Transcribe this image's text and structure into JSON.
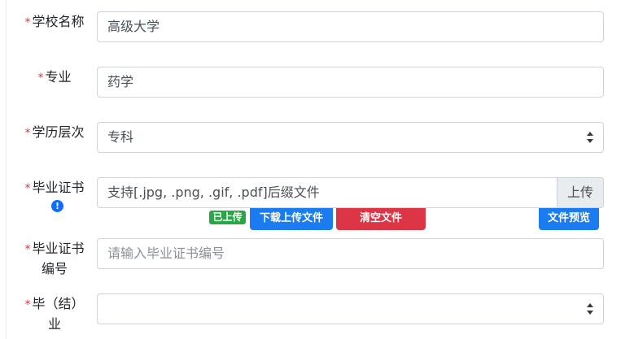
{
  "form": {
    "required_mark": "*",
    "school_name": {
      "label": "学校名称",
      "value": "高级大学"
    },
    "major": {
      "label": "专业",
      "value": "药学"
    },
    "education_level": {
      "label": "学历层次",
      "value": "专科"
    },
    "diploma": {
      "label": "毕业证书",
      "info_icon": "!",
      "placeholder": "支持[.jpg, .png, .gif, .pdf]后缀文件",
      "upload_button": "上传",
      "status_badge": "已上传",
      "download_button": "下载上传文件",
      "clear_button": "清空文件",
      "preview_button": "文件预览"
    },
    "diploma_number": {
      "label_line1": "毕业证书",
      "label_line2": "编号",
      "placeholder": "请输入毕业证书编号"
    },
    "graduation": {
      "label_line1": "毕（结）",
      "label_line2": "业",
      "value": ""
    }
  },
  "colors": {
    "required": "#dc3545",
    "primary": "#1a7cf0",
    "danger": "#dc3545",
    "success": "#28a745",
    "border": "#ced4da"
  }
}
